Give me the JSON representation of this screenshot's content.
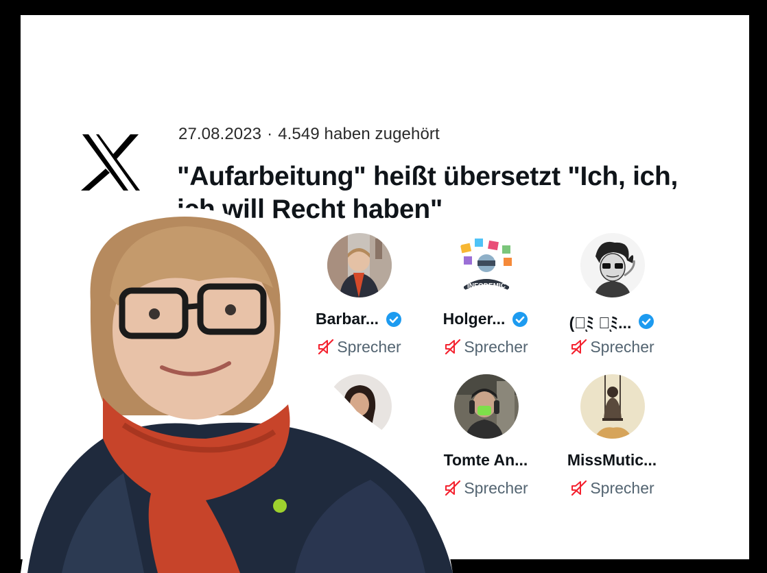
{
  "space": {
    "date": "27.08.2023",
    "separator": "·",
    "listeners": "4.549 haben zugehört",
    "title": "\"Aufarbeitung\" heißt übersetzt \"Ich, ich, ich will Recht haben\""
  },
  "speakers": [
    {
      "name": "Barbar...",
      "role": "Sprecher",
      "verified": true
    },
    {
      "name": "Holger...",
      "role": "Sprecher",
      "verified": true
    },
    {
      "name": "(ㅅͅﾐ ㅋͅﾐ...",
      "role": "Sprecher",
      "verified": true
    },
    {
      "name": "",
      "role": "",
      "verified": false
    },
    {
      "name": "Tomte An...",
      "role": "Sprecher",
      "verified": false
    },
    {
      "name": "MissMutic...",
      "role": "Sprecher",
      "verified": false
    }
  ],
  "logos": {
    "infodemic": "INFODEMIC"
  },
  "colors": {
    "verified_blue": "#1d9bf0",
    "muted_red": "#f4212e",
    "text_dark": "#0f1419",
    "text_grey": "#536471"
  },
  "icons": [
    "x-logo-icon",
    "verified-badge-icon",
    "microphone-muted-icon"
  ]
}
